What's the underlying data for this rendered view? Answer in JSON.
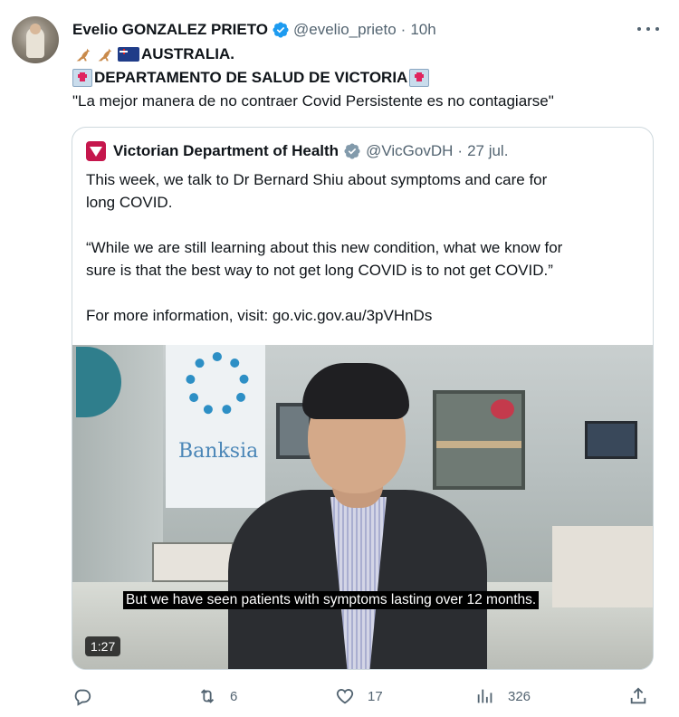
{
  "tweet": {
    "author_name": "Evelio GONZALEZ PRIETO",
    "handle": "@evelio_prieto",
    "separator": "·",
    "time": "10h",
    "line1_text": "AUSTRALIA.",
    "line2_text": "DEPARTAMENTO DE SALUD DE VICTORIA",
    "line3_text": "\"La mejor manera de no contraer Covid Persistente es no contagiarse\""
  },
  "quote": {
    "author_name": "Victorian Department of Health",
    "handle": "@VicGovDH",
    "separator": "·",
    "date": "27 jul.",
    "text_line1": "This week, we talk to Dr Bernard Shiu about symptoms and care for",
    "text_line2": "long COVID.",
    "text_line3": "“While we are still learning about this new condition, what we know for",
    "text_line4": "sure is that the best way to not get long COVID is to not get COVID.”",
    "text_line5": "For more information, visit: go.vic.gov.au/3pVHnDs",
    "video": {
      "caption": "But we have seen patients with symptoms lasting over 12 months.",
      "duration": "1:27",
      "poster_text": "Banksia"
    }
  },
  "actions": {
    "reply_count": "",
    "retweet_count": "6",
    "like_count": "17",
    "views_count": "326"
  },
  "colors": {
    "verified_blue": "#1d9bf0",
    "gov_verified_gray": "#829aab",
    "muted_text": "#536471",
    "text": "#0f1419",
    "border": "#cfd9de",
    "vic_logo": "#c5164c"
  },
  "icons": [
    "more-icon",
    "verified-icon",
    "kangaroo-emoji",
    "australia-flag-emoji",
    "hospital-emoji",
    "gov-verified-icon",
    "reply-icon",
    "retweet-icon",
    "like-icon",
    "views-icon",
    "share-icon"
  ]
}
